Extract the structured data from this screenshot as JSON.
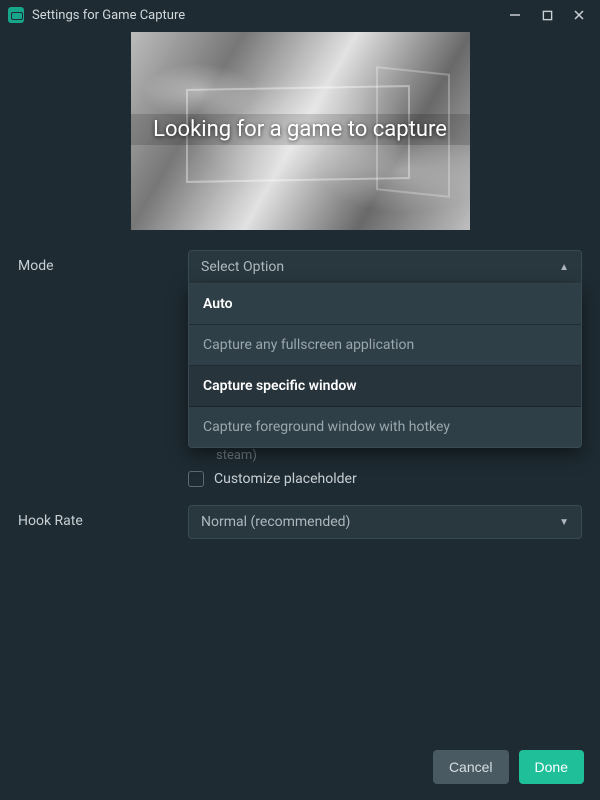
{
  "window": {
    "title": "Settings for Game Capture"
  },
  "preview": {
    "overlay_text": "Looking for a game to capture"
  },
  "labels": {
    "mode": "Mode",
    "hook_rate": "Hook Rate"
  },
  "mode_select": {
    "placeholder": "Select Option",
    "options": [
      "Auto",
      "Capture any fullscreen application",
      "Capture specific window",
      "Capture foreground window with hotkey"
    ],
    "selected_index": 0,
    "hover_index": 2
  },
  "obscured": {
    "truncated_line": "steam)",
    "checkbox_label": "Customize placeholder"
  },
  "hook_rate_select": {
    "value": "Normal (recommended)"
  },
  "footer": {
    "cancel": "Cancel",
    "done": "Done"
  }
}
